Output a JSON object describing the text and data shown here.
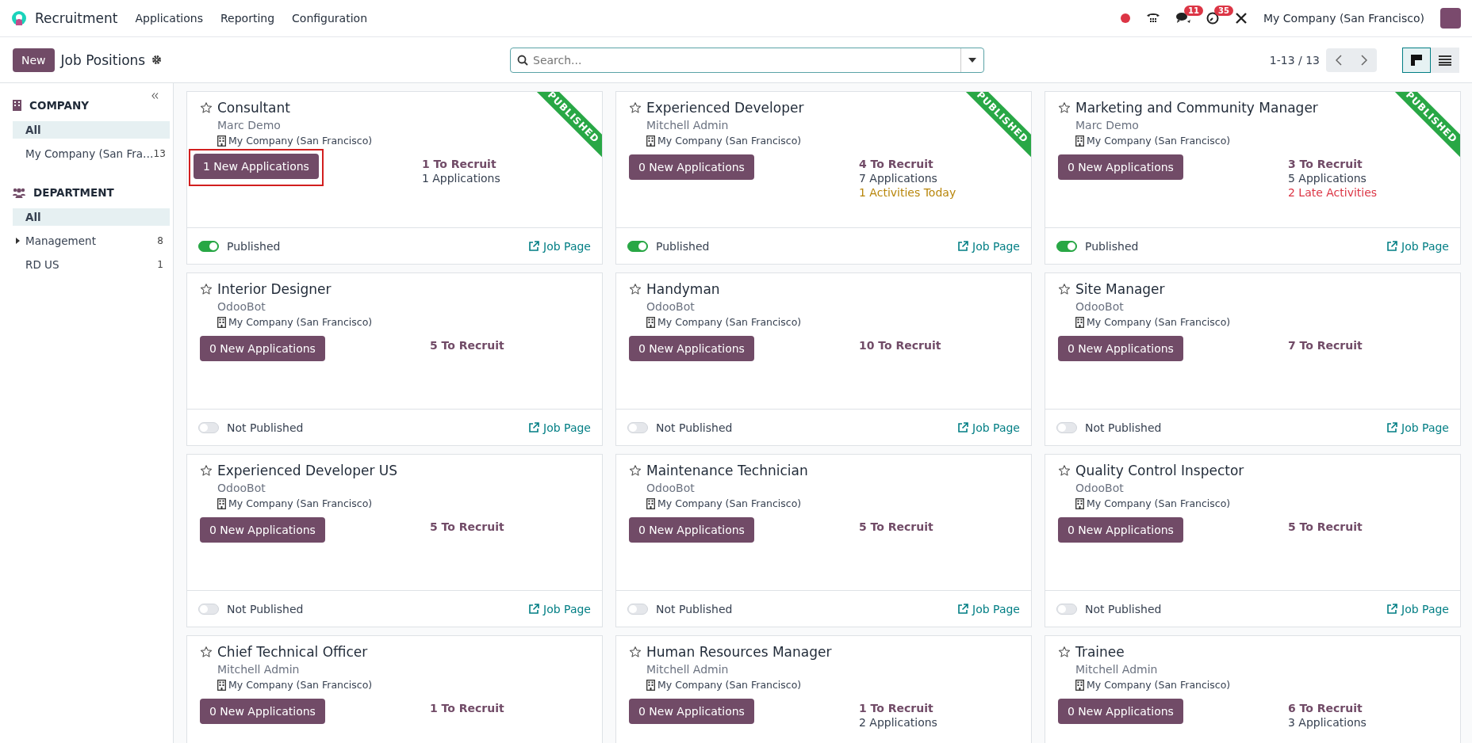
{
  "navbar": {
    "app_name": "Recruitment",
    "menus": [
      "Applications",
      "Reporting",
      "Configuration"
    ],
    "messages_badge": "11",
    "activities_badge": "35",
    "company": "My Company (San Francisco)"
  },
  "control_panel": {
    "new_button": "New",
    "title": "Job Positions",
    "search": {
      "placeholder": "Search..."
    },
    "pager": "1-13 / 13",
    "views": [
      {
        "kind": "kanban",
        "selected": true
      },
      {
        "kind": "list",
        "selected": false
      }
    ]
  },
  "sidebar": {
    "sections": [
      {
        "kind": "company",
        "title": "COMPANY",
        "items": [
          {
            "label": "All",
            "selected": true,
            "expandable": false
          },
          {
            "label": "My Company (San Fra…",
            "count": "13",
            "selected": false,
            "expandable": false
          }
        ]
      },
      {
        "kind": "department",
        "title": "DEPARTMENT",
        "items": [
          {
            "label": "All",
            "selected": true,
            "expandable": false
          },
          {
            "label": "Management",
            "count": "8",
            "selected": false,
            "expandable": true
          },
          {
            "label": "RD US",
            "count": "1",
            "selected": false,
            "expandable": false
          }
        ]
      }
    ]
  },
  "cards": [
    {
      "title": "Consultant",
      "manager": "Marc Demo",
      "company": "My Company (San Francisco)",
      "button": "1 New Applications",
      "highlighted": true,
      "ribbon": "PUBLISHED",
      "stats": [
        {
          "kind": "recruit",
          "text": "1 To Recruit"
        },
        {
          "kind": "applications",
          "text": "1 Applications"
        }
      ],
      "published": true,
      "status": "Published",
      "link": "Job Page"
    },
    {
      "title": "Experienced Developer",
      "manager": "Mitchell Admin",
      "company": "My Company (San Francisco)",
      "button": "0 New Applications",
      "highlighted": false,
      "ribbon": "PUBLISHED",
      "stats": [
        {
          "kind": "recruit",
          "text": "4 To Recruit"
        },
        {
          "kind": "applications",
          "text": "7 Applications"
        },
        {
          "kind": "today",
          "text": "1 Activities Today"
        }
      ],
      "published": true,
      "status": "Published",
      "link": "Job Page"
    },
    {
      "title": "Marketing and Community Manager",
      "manager": "Marc Demo",
      "company": "My Company (San Francisco)",
      "button": "0 New Applications",
      "highlighted": false,
      "ribbon": "PUBLISHED",
      "stats": [
        {
          "kind": "recruit",
          "text": "3 To Recruit"
        },
        {
          "kind": "applications",
          "text": "5 Applications"
        },
        {
          "kind": "late",
          "text": "2 Late Activities"
        }
      ],
      "published": true,
      "status": "Published",
      "link": "Job Page"
    },
    {
      "title": "Interior Designer",
      "manager": "OdooBot",
      "company": "My Company (San Francisco)",
      "button": "0 New Applications",
      "highlighted": false,
      "stats": [
        {
          "kind": "recruit",
          "text": "5 To Recruit"
        }
      ],
      "published": false,
      "status": "Not Published",
      "link": "Job Page"
    },
    {
      "title": "Handyman",
      "manager": "OdooBot",
      "company": "My Company (San Francisco)",
      "button": "0 New Applications",
      "highlighted": false,
      "stats": [
        {
          "kind": "recruit",
          "text": "10 To Recruit"
        }
      ],
      "published": false,
      "status": "Not Published",
      "link": "Job Page"
    },
    {
      "title": "Site Manager",
      "manager": "OdooBot",
      "company": "My Company (San Francisco)",
      "button": "0 New Applications",
      "highlighted": false,
      "stats": [
        {
          "kind": "recruit",
          "text": "7 To Recruit"
        }
      ],
      "published": false,
      "status": "Not Published",
      "link": "Job Page"
    },
    {
      "title": "Experienced Developer US",
      "manager": "OdooBot",
      "company": "My Company (San Francisco)",
      "button": "0 New Applications",
      "highlighted": false,
      "stats": [
        {
          "kind": "recruit",
          "text": "5 To Recruit"
        }
      ],
      "published": false,
      "status": "Not Published",
      "link": "Job Page"
    },
    {
      "title": "Maintenance Technician",
      "manager": "OdooBot",
      "company": "My Company (San Francisco)",
      "button": "0 New Applications",
      "highlighted": false,
      "stats": [
        {
          "kind": "recruit",
          "text": "5 To Recruit"
        }
      ],
      "published": false,
      "status": "Not Published",
      "link": "Job Page"
    },
    {
      "title": "Quality Control Inspector",
      "manager": "OdooBot",
      "company": "My Company (San Francisco)",
      "button": "0 New Applications",
      "highlighted": false,
      "stats": [
        {
          "kind": "recruit",
          "text": "5 To Recruit"
        }
      ],
      "published": false,
      "status": "Not Published",
      "link": "Job Page"
    },
    {
      "title": "Chief Technical Officer",
      "manager": "Mitchell Admin",
      "company": "My Company (San Francisco)",
      "button": "0 New Applications",
      "highlighted": false,
      "stats": [
        {
          "kind": "recruit",
          "text": "1 To Recruit"
        }
      ]
    },
    {
      "title": "Human Resources Manager",
      "manager": "Mitchell Admin",
      "company": "My Company (San Francisco)",
      "button": "0 New Applications",
      "highlighted": false,
      "stats": [
        {
          "kind": "recruit",
          "text": "1 To Recruit"
        },
        {
          "kind": "applications",
          "text": "2 Applications"
        }
      ]
    },
    {
      "title": "Trainee",
      "manager": "Mitchell Admin",
      "company": "My Company (San Francisco)",
      "button": "0 New Applications",
      "highlighted": false,
      "stats": [
        {
          "kind": "recruit",
          "text": "6 To Recruit"
        },
        {
          "kind": "applications",
          "text": "3 Applications"
        }
      ]
    }
  ]
}
